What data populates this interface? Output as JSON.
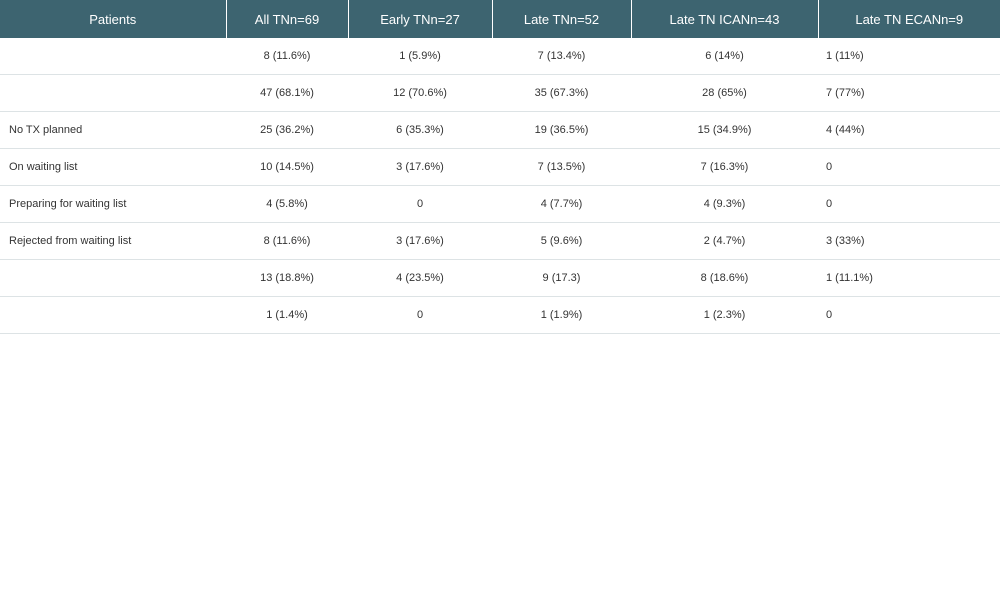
{
  "table": {
    "headers": [
      "Patients",
      "All TNn=69",
      "Early TNn=27",
      "Late TNn=52",
      "Late TN ICANn=43",
      "Late TN ECANn=9"
    ],
    "rows": [
      {
        "label": "",
        "cells": [
          "8 (11.6%)",
          "1 (5.9%)",
          "7 (13.4%)",
          "6 (14%)",
          "1 (11%)"
        ]
      },
      {
        "label": "",
        "cells": [
          "47 (68.1%)",
          "12 (70.6%)",
          "35 (67.3%)",
          "28 (65%)",
          "7 (77%)"
        ]
      },
      {
        "label": "No TX planned",
        "cells": [
          "25 (36.2%)",
          "6 (35.3%)",
          "19 (36.5%)",
          "15 (34.9%)",
          "4 (44%)"
        ]
      },
      {
        "label": "On waiting list",
        "cells": [
          "10 (14.5%)",
          "3 (17.6%)",
          "7 (13.5%)",
          "7 (16.3%)",
          "0"
        ]
      },
      {
        "label": "Preparing for waiting list",
        "cells": [
          "4 (5.8%)",
          "0",
          "4 (7.7%)",
          "4 (9.3%)",
          "0"
        ]
      },
      {
        "label": "Rejected from waiting list",
        "cells": [
          "8 (11.6%)",
          "3 (17.6%)",
          "5 (9.6%)",
          "2 (4.7%)",
          "3 (33%)"
        ]
      },
      {
        "label": "",
        "cells": [
          "13 (18.8%)",
          "4 (23.5%)",
          "9 (17.3)",
          "8 (18.6%)",
          "1 (11.1%)"
        ]
      },
      {
        "label": "",
        "cells": [
          "1 (1.4%)",
          "0",
          "1 (1.9%)",
          "1 (2.3%)",
          "0"
        ]
      }
    ]
  }
}
